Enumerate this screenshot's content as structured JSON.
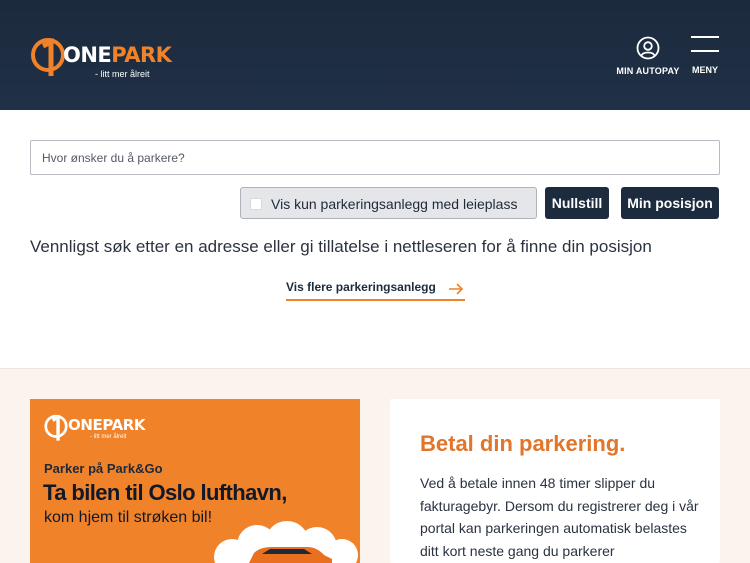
{
  "header": {
    "logo_word_white": "ONE",
    "logo_word_orange": "PARK",
    "logo_tagline": "- litt mer ålreit",
    "autopay_label": "MIN AUTOPAY",
    "autopay_icon": "user-circle-icon",
    "menu_label": "MENY",
    "menu_icon": "hamburger-icon"
  },
  "search": {
    "placeholder": "Hvor ønsker du å parkere?",
    "value": "",
    "filter_label": "Vis kun parkeringsanlegg med leieplass",
    "filter_checked": false,
    "reset_label": "Nullstill",
    "position_label": "Min posisjon"
  },
  "notice": "Vennligst søk etter en adresse eller gi tillatelse i nettleseren for å finne din posisjon",
  "more_link": {
    "label": "Vis flere parkeringsanlegg",
    "icon": "arrow-right-icon"
  },
  "banner": {
    "logo_word": "ONEPARK",
    "logo_tagline": "- litt mer ålreit",
    "subtitle": "Parker på Park&Go",
    "headline": "Ta bilen til Oslo lufthavn,",
    "line": "kom hjem til strøken bil!"
  },
  "info_card": {
    "title": "Betal din parkering.",
    "body": "Ved å betale innen 48 timer slipper du fakturagebyr. Dersom du registrerer deg i vår portal kan parkeringen automatisk belastes ditt kort neste gang du parkerer"
  },
  "colors": {
    "header_bg": "#1c2a3d",
    "accent": "#f0822a",
    "dark_button": "#1d2b3e",
    "lower_bg": "#fbf3ee"
  }
}
